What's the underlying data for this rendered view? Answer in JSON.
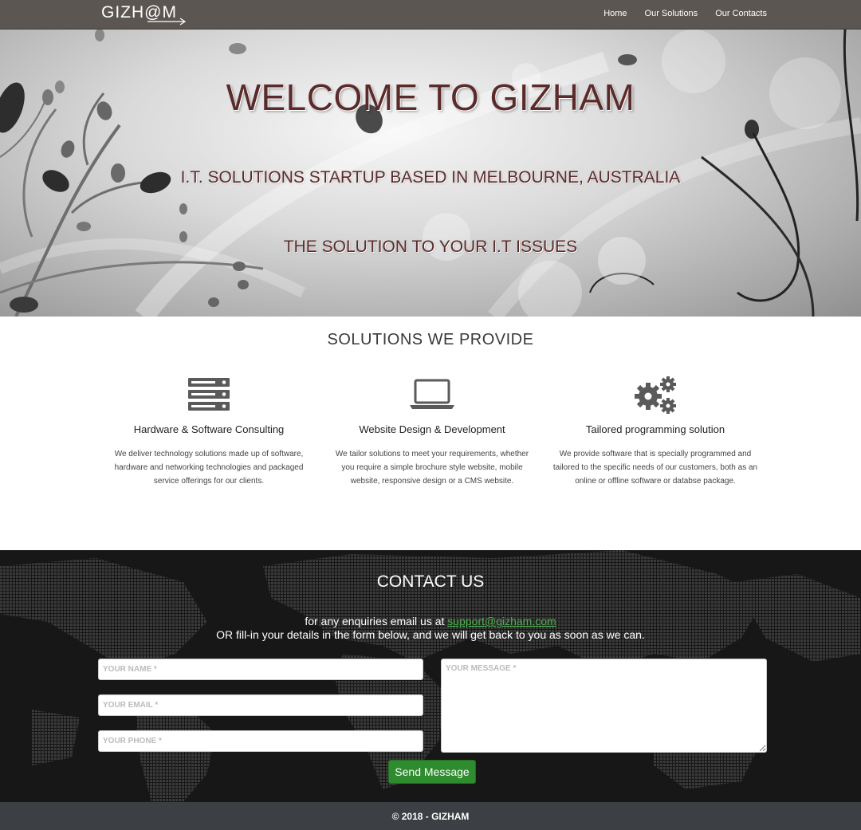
{
  "navbar": {
    "brand": "GIZH@M",
    "links": [
      "Home",
      "Our Solutions",
      "Our Contacts"
    ]
  },
  "hero": {
    "title": "WELCOME TO GIZHAM",
    "subtitle": "I.T. SOLUTIONS STARTUP BASED IN MELBOURNE, AUSTRALIA",
    "tagline": "THE SOLUTION TO YOUR I.T ISSUES"
  },
  "solutions": {
    "title": "SOLUTIONS WE PROVIDE",
    "items": [
      {
        "icon": "server-icon",
        "heading": "Hardware & Software Consulting",
        "text": "We deliver technology solutions made up of software, hardware and networking technologies and packaged service offerings for our clients."
      },
      {
        "icon": "laptop-icon",
        "heading": "Website Design & Development",
        "text": "We tailor solutions to meet your requirements, whether you require a simple brochure style website, mobile website, responsive design or a CMS website."
      },
      {
        "icon": "gears-icon",
        "heading": "Tailored programming solution",
        "text": "We provide software that is specially programmed and tailored to the specific needs of our customers, both as an online or offline software or databse package."
      }
    ]
  },
  "contact": {
    "title": "CONTACT US",
    "line1_prefix": "for any enquiries email us at ",
    "email": "support@gizham.com",
    "line2": "OR fill-in your details in the form below, and we will get back to you as soon as we can.",
    "name_placeholder": "YOUR NAME *",
    "email_placeholder": "YOUR EMAIL *",
    "phone_placeholder": "YOUR PHONE *",
    "message_placeholder": "YOUR MESSAGE *",
    "send_label": "Send Message"
  },
  "footer": {
    "copyright": "© 2018 - GIZHAM"
  },
  "colors": {
    "navbar": "#5b5651",
    "hero_text": "#5b2a2a",
    "link_green": "#4caf50",
    "button_green": "#2e8b2e",
    "footer": "#3c4044"
  }
}
